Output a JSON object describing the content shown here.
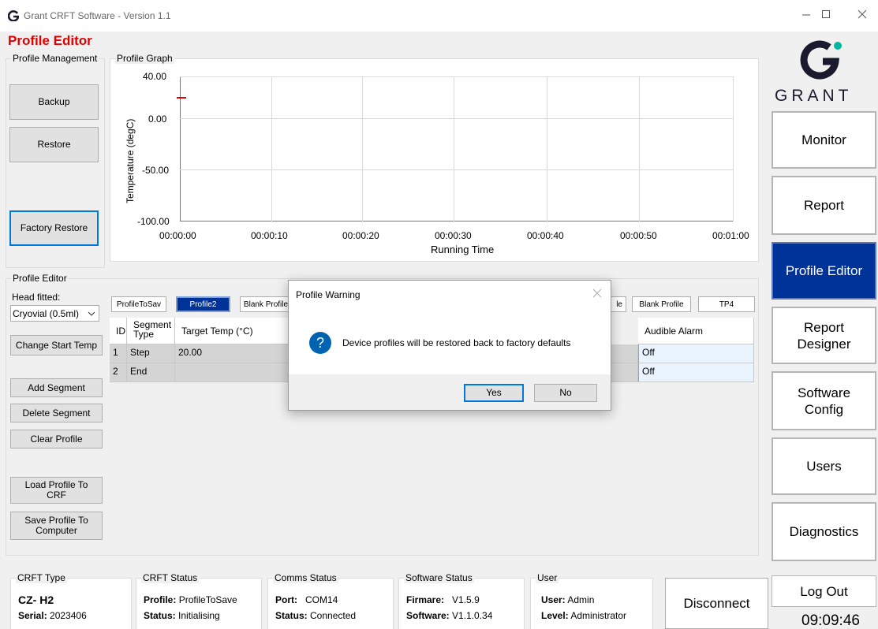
{
  "window": {
    "title": "Grant CRFT Software - Version 1.1",
    "page_title": "Profile Editor",
    "logo_text": "GRANT"
  },
  "profile_management": {
    "label": "Profile Management",
    "backup": "Backup",
    "restore": "Restore",
    "factory_restore": "Factory Restore"
  },
  "graph": {
    "label": "Profile Graph",
    "y_label": "Temperature (degC)",
    "x_label": "Running Time",
    "y_ticks": [
      "40.00",
      "0.00",
      "-50.00",
      "-100.00"
    ],
    "x_ticks": [
      "00:00:00",
      "00:00:10",
      "00:00:20",
      "00:00:30",
      "00:00:40",
      "00:00:50",
      "00:01:00"
    ]
  },
  "chart_data": {
    "type": "line",
    "xlabel": "Running Time",
    "ylabel": "Temperature (degC)",
    "ylim": [
      -100,
      40
    ],
    "xlim": [
      "00:00:00",
      "00:01:00"
    ],
    "series": [
      {
        "x": [
          "00:00:00"
        ],
        "values": [
          20
        ],
        "color": "#e00000"
      }
    ]
  },
  "profile_editor": {
    "label": "Profile Editor",
    "head_fitted_label": "Head fitted:",
    "head_fitted_value": "Cryovial (0.5ml)",
    "change_start_temp": "Change Start Temp",
    "add_segment": "Add Segment",
    "delete_segment": "Delete Segment",
    "clear_profile": "Clear Profile",
    "load_profile": "Load Profile To CRF",
    "save_profile": "Save Profile To Computer",
    "tabs": [
      "ProfileToSav",
      "Profile2",
      "Blank Profile",
      "le",
      "Blank Profile",
      "TP4"
    ],
    "columns": [
      "ID",
      "Segment Type",
      "Target Temp (°C)",
      "Audible Alarm"
    ],
    "rows": [
      {
        "id": "1",
        "type": "Step",
        "target": "20.00",
        "alarm": "Off"
      },
      {
        "id": "2",
        "type": "End",
        "target": "",
        "alarm": "Off"
      }
    ]
  },
  "nav": {
    "monitor": "Monitor",
    "report": "Report",
    "profile_editor": "Profile Editor",
    "report_designer": "Report\nDesigner",
    "software_config": "Software\nConfig",
    "users": "Users",
    "diagnostics": "Diagnostics",
    "log_out": "Log Out",
    "disconnect": "Disconnect",
    "clock": "09:09:46"
  },
  "status": {
    "crft_type": {
      "label": "CRFT Type",
      "model": "CZ- H2",
      "serial_label": "Serial:",
      "serial": "2023406"
    },
    "crft_status": {
      "label": "CRFT Status",
      "profile_label": "Profile:",
      "profile": "ProfileToSave",
      "status_label": "Status:",
      "status": "Initialising"
    },
    "comms": {
      "label": "Comms Status",
      "port_label": "Port:",
      "port": "COM14",
      "status_label": "Status:",
      "status": "Connected"
    },
    "software": {
      "label": "Software Status",
      "firmware_label": "Firmare:",
      "firmware": "V1.5.9",
      "software_label": "Software:",
      "software": "V1.1.0.34"
    },
    "user": {
      "label": "User",
      "user_label": "User:",
      "user": "Admin",
      "level_label": "Level:",
      "level": "Administrator"
    }
  },
  "dialog": {
    "title": "Profile Warning",
    "message": "Device profiles will be restored back to factory defaults",
    "yes": "Yes",
    "no": "No",
    "accent": "#0063b1"
  }
}
